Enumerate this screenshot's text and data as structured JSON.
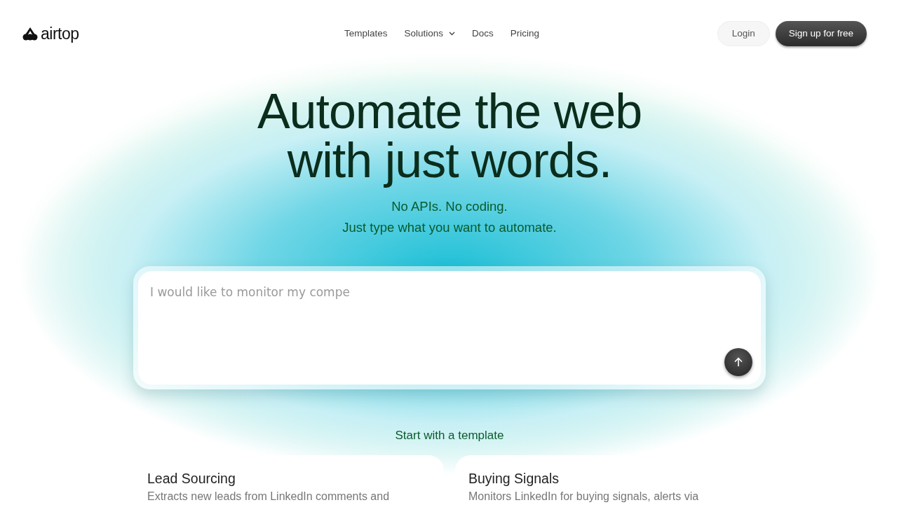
{
  "brand": {
    "name": "airtop"
  },
  "nav": [
    {
      "label": "Templates",
      "dropdown": false
    },
    {
      "label": "Solutions",
      "dropdown": true
    },
    {
      "label": "Docs",
      "dropdown": false
    },
    {
      "label": "Pricing",
      "dropdown": false
    }
  ],
  "actions": {
    "login": "Login",
    "signup": "Sign up for free"
  },
  "hero": {
    "title_lines": [
      "Automate the web",
      "with just words."
    ],
    "subtitle_lines": [
      "No APIs. No coding.",
      "Just type what you want to automate."
    ]
  },
  "prompt": {
    "placeholder": "I would like to monitor my compe"
  },
  "templates": {
    "heading": "Start with a template",
    "cards": [
      {
        "title": "Lead Sourcing",
        "description": "Extracts new leads from LinkedIn comments and"
      },
      {
        "title": "Buying Signals",
        "description": "Monitors LinkedIn for buying signals, alerts via"
      }
    ]
  }
}
